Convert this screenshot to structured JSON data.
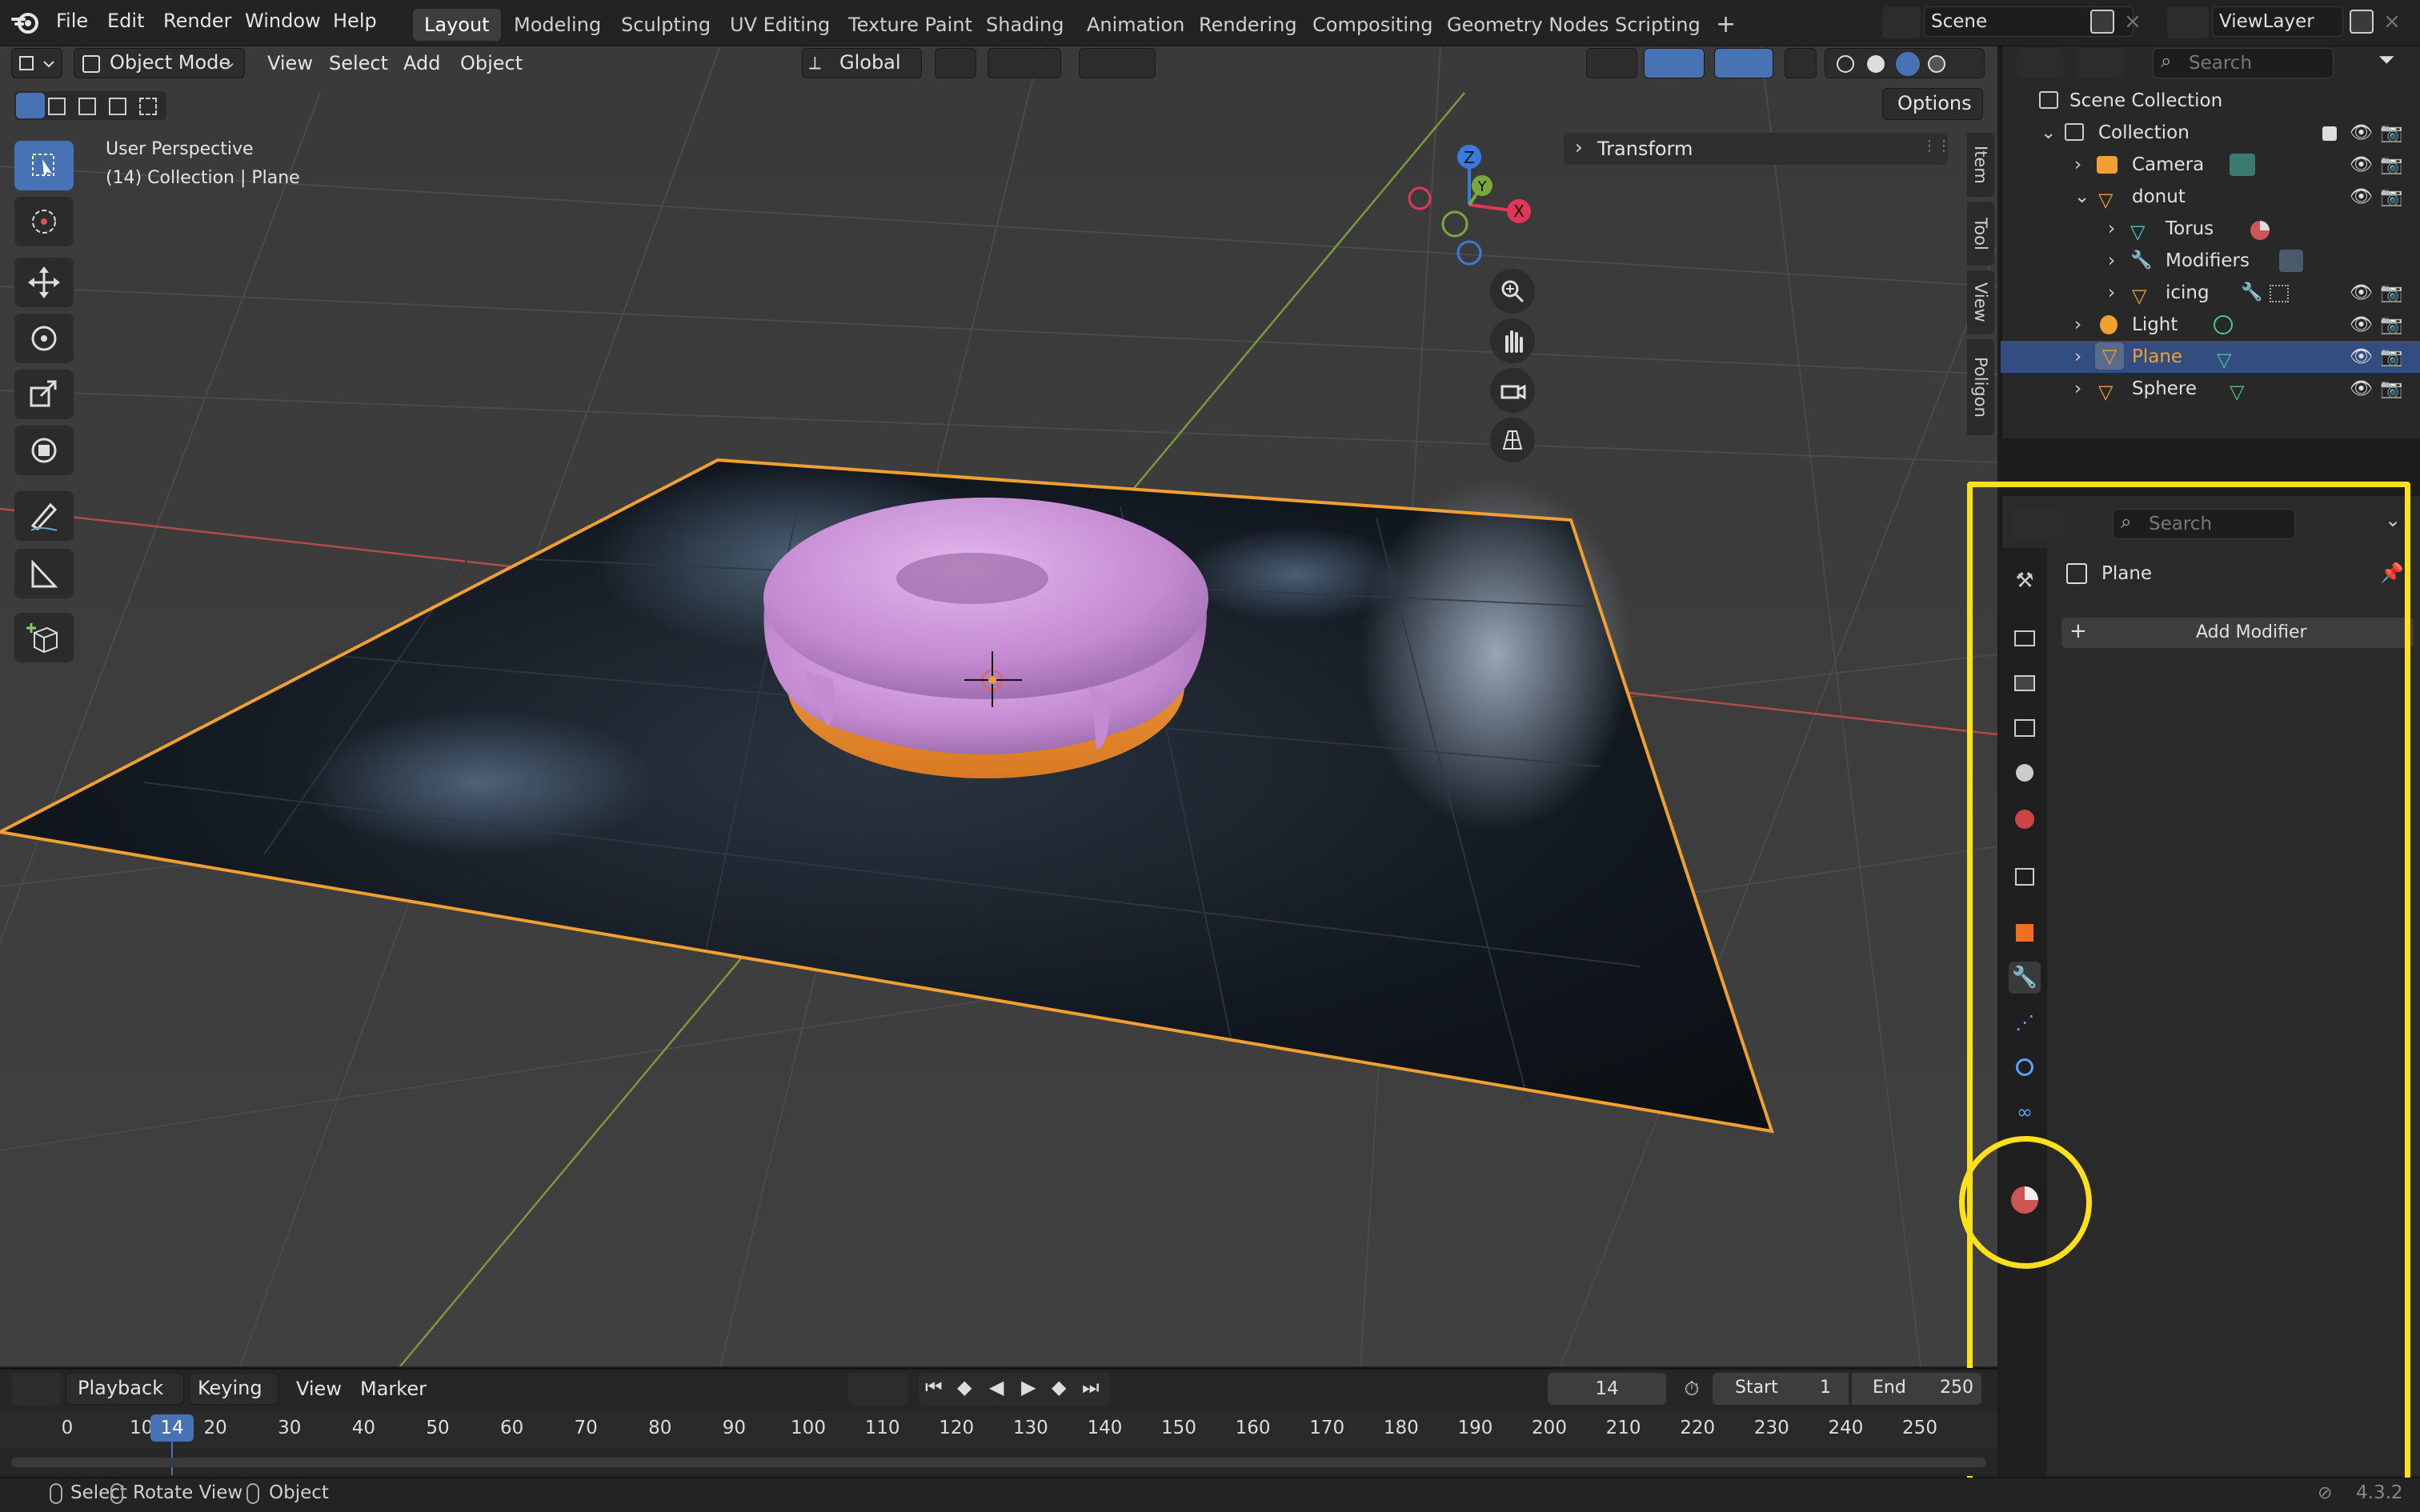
{
  "menu": {
    "file": "File",
    "edit": "Edit",
    "render": "Render",
    "window": "Window",
    "help": "Help"
  },
  "workspaces": [
    "Layout",
    "Modeling",
    "Sculpting",
    "UV Editing",
    "Texture Paint",
    "Shading",
    "Animation",
    "Rendering",
    "Compositing",
    "Geometry Nodes",
    "Scripting"
  ],
  "topbar": {
    "add_ws": "+",
    "scene": "Scene",
    "view_layer": "ViewLayer"
  },
  "viewport_header": {
    "mode": "Object Mode",
    "view": "View",
    "select": "Select",
    "add": "Add",
    "object": "Object",
    "orientation": "Global",
    "options": "Options"
  },
  "overlay": {
    "line1": "User Perspective",
    "line2": "(14) Collection | Plane",
    "transform": "Transform"
  },
  "gizmo": {
    "z": "Z",
    "y": "Y",
    "x": "X"
  },
  "side_tabs": [
    "Item",
    "Tool",
    "View",
    "Poligon"
  ],
  "outliner": {
    "search_placeholder": "Search",
    "rows": [
      {
        "label": "Scene Collection"
      },
      {
        "label": "Collection"
      },
      {
        "label": "Camera"
      },
      {
        "label": "donut"
      },
      {
        "label": "Torus"
      },
      {
        "label": "Modifiers"
      },
      {
        "label": "icing"
      },
      {
        "label": "Light"
      },
      {
        "label": "Plane"
      },
      {
        "label": "Sphere"
      }
    ]
  },
  "properties": {
    "search_placeholder": "Search",
    "object_name": "Plane",
    "add_modifier": "Add Modifier"
  },
  "timeline": {
    "playback": "Playback",
    "keying": "Keying",
    "view": "View",
    "marker": "Marker",
    "current_frame": "14",
    "start_label": "Start",
    "start": "1",
    "end_label": "End",
    "end": "250",
    "ticks": [
      "0",
      "10",
      "20",
      "30",
      "40",
      "50",
      "60",
      "70",
      "80",
      "90",
      "100",
      "110",
      "120",
      "130",
      "140",
      "150",
      "160",
      "170",
      "180",
      "190",
      "200",
      "210",
      "220",
      "230",
      "240",
      "250"
    ],
    "playhead": "14"
  },
  "statusbar": {
    "select": "Select",
    "rotate": "Rotate View",
    "object": "Object",
    "version": "4.3.2"
  },
  "colors": {
    "accent": "#4772b3",
    "highlight": "#ffe01a",
    "selection": "#f0a030"
  }
}
